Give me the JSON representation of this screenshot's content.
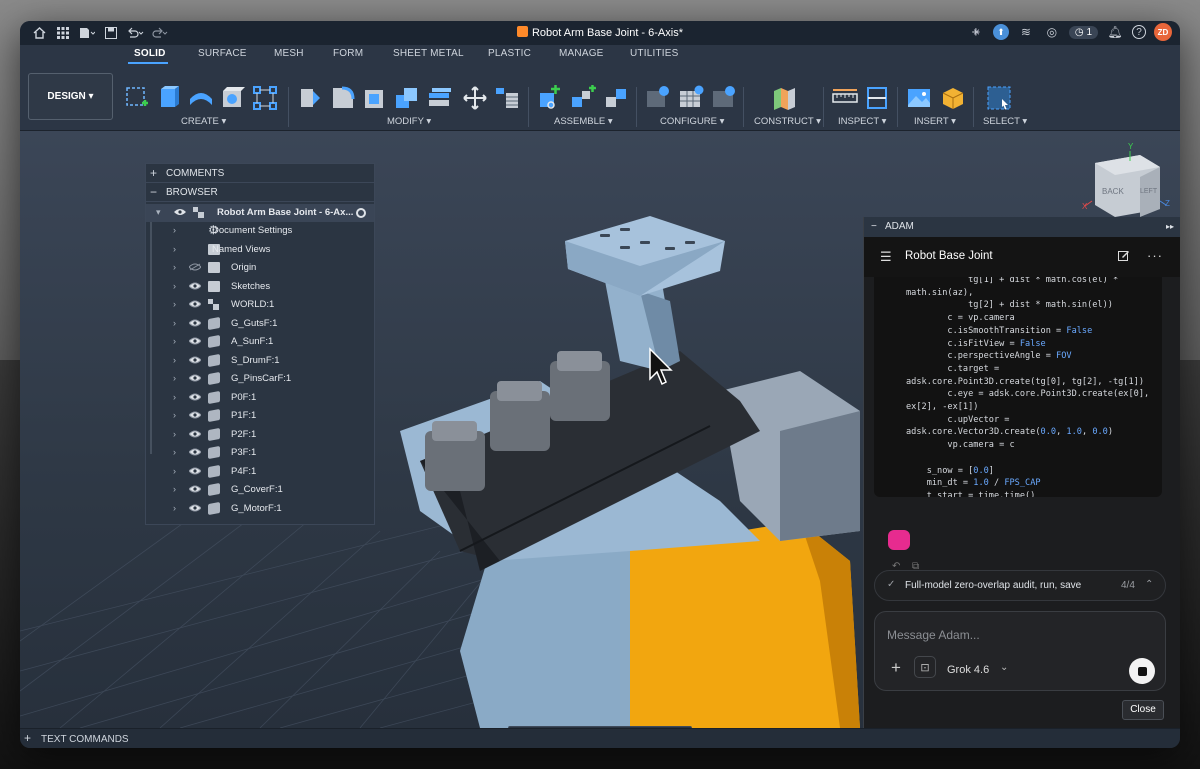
{
  "window": {
    "doc_title": "Robot Arm Base Joint - 6-Axis*",
    "close_tab": "×",
    "notification_count": "1",
    "user_initials": "ZD"
  },
  "toolbar": {
    "tabs": [
      "SOLID",
      "SURFACE",
      "MESH",
      "FORM",
      "SHEET METAL",
      "PLASTIC",
      "MANAGE",
      "UTILITIES"
    ],
    "workspace_button": "DESIGN ▾",
    "groups": [
      "CREATE ▾",
      "MODIFY ▾",
      "ASSEMBLE ▾",
      "CONFIGURE ▾",
      "CONSTRUCT ▾",
      "INSPECT ▾",
      "INSERT ▾",
      "SELECT ▾"
    ]
  },
  "browser": {
    "comments_label": "COMMENTS",
    "browser_label": "BROWSER",
    "root": "Robot Arm Base Joint - 6-Ax...",
    "items": [
      {
        "label": "Document Settings",
        "kind": "gear"
      },
      {
        "label": "Named Views",
        "kind": "folder"
      },
      {
        "label": "Origin",
        "kind": "folder",
        "hidden": true
      },
      {
        "label": "Sketches",
        "kind": "folder"
      },
      {
        "label": "WORLD:1",
        "kind": "component"
      },
      {
        "label": "G_GutsF:1",
        "kind": "body"
      },
      {
        "label": "A_SunF:1",
        "kind": "body"
      },
      {
        "label": "S_DrumF:1",
        "kind": "body"
      },
      {
        "label": "G_PinsCarF:1",
        "kind": "body"
      },
      {
        "label": "P0F:1",
        "kind": "body"
      },
      {
        "label": "P1F:1",
        "kind": "body"
      },
      {
        "label": "P2F:1",
        "kind": "body"
      },
      {
        "label": "P3F:1",
        "kind": "body"
      },
      {
        "label": "P4F:1",
        "kind": "body"
      },
      {
        "label": "G_CoverF:1",
        "kind": "body"
      },
      {
        "label": "G_MotorF:1",
        "kind": "body"
      }
    ]
  },
  "viewcube": {
    "face_back": "BACK",
    "face_left": "LEFT",
    "axis_x": "X",
    "axis_y": "Y",
    "axis_z": "Z"
  },
  "adam": {
    "panel_label": "ADAM",
    "chat_title": "Robot Base Joint",
    "code_lines": [
      "            tg[1] + dist * math.cos(el) *",
      "math.sin(az),",
      "            tg[2] + dist * math.sin(el))",
      "        c = vp.camera",
      "        c.isSmoothTransition = False",
      "        c.isFitView = False",
      "        c.perspectiveAngle = FOV",
      "        c.target =",
      "adsk.core.Point3D.create(tg[0], tg[2], -tg[1])",
      "        c.eye = adsk.core.Point3D.create(ex[0],",
      "ex[2], -ex[1])",
      "        c.upVector =",
      "adsk.core.Vector3D.create(0.0, 1.0, 0.0)",
      "        vp.camera = c",
      "",
      "    s_now = [0.0]",
      "    min_dt = 1.0 / FPS_CAP",
      "    t_start = time.time()"
    ],
    "task_label": "Full-model zero-overlap audit, run, save",
    "task_progress": "4/4",
    "input_placeholder": "Message Adam...",
    "model_name": "Grok 4.6",
    "close_label": "Close"
  },
  "bottom": {
    "text_commands": "TEXT COMMANDS"
  },
  "colors": {
    "accent": "#4aa3ff",
    "adam_logo": "#e72b8f",
    "part_blue": "#8fb0cc",
    "part_orange": "#f2a60f"
  }
}
